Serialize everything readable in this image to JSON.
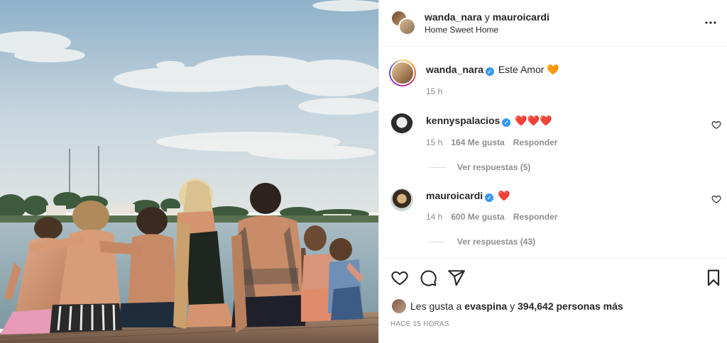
{
  "header": {
    "user1": "wanda_nara",
    "conjunction": "y",
    "user2": "mauroicardi",
    "location": "Home Sweet Home",
    "more_icon": "more-horizontal-icon"
  },
  "caption": {
    "username": "wanda_nara",
    "text": "Este Amor",
    "emoji": "🧡",
    "time": "15 h"
  },
  "comments": [
    {
      "username": "kennyspalacios",
      "text": "❤️❤️❤️",
      "time": "15 h",
      "likes": "164 Me gusta",
      "reply_label": "Responder",
      "view_replies": "Ver respuestas (5)"
    },
    {
      "username": "mauroicardi",
      "text": "❤️",
      "time": "14 h",
      "likes": "600 Me gusta",
      "reply_label": "Responder",
      "view_replies": "Ver respuestas (43)"
    }
  ],
  "likes": {
    "prefix": "Les gusta a",
    "user": "evaspina",
    "connector": "y",
    "count": "394,642 personas más"
  },
  "posted": "HACE 15 HORAS",
  "colors": {
    "text": "#262626",
    "secondary": "#8e8e8e",
    "verified": "#3897f0",
    "border": "#efefef"
  }
}
